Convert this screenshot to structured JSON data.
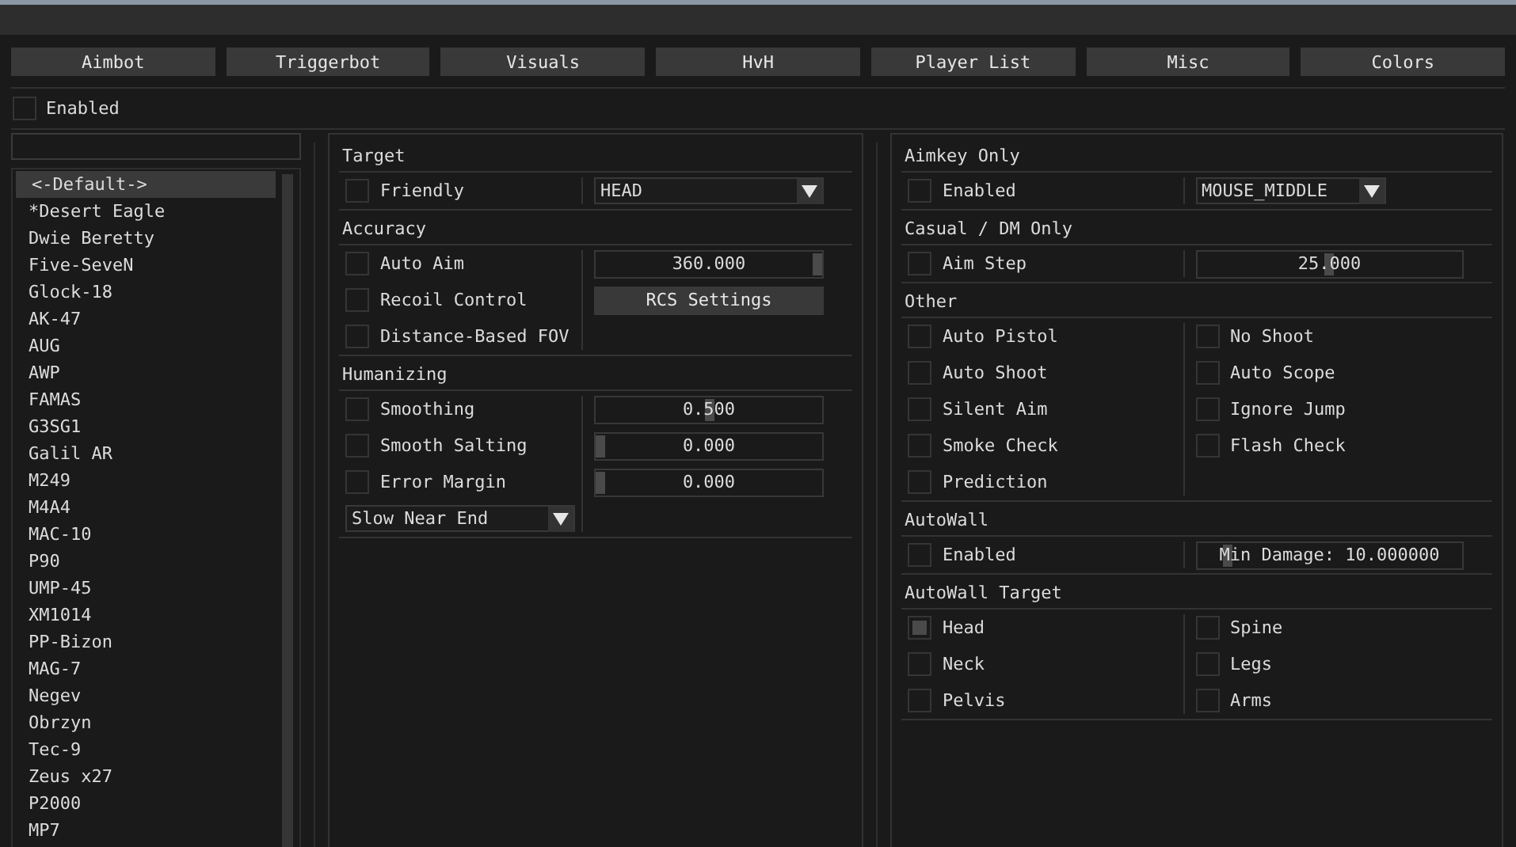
{
  "tabs": [
    {
      "label": "Aimbot"
    },
    {
      "label": "Triggerbot"
    },
    {
      "label": "Visuals"
    },
    {
      "label": "HvH"
    },
    {
      "label": "Player List"
    },
    {
      "label": "Misc"
    },
    {
      "label": "Colors"
    }
  ],
  "enabled": {
    "label": "Enabled",
    "checked": false
  },
  "weapons": [
    {
      "label": "<-Default->",
      "selected": true
    },
    {
      "label": "*Desert Eagle",
      "selected": false
    },
    {
      "label": "Dwie Beretty",
      "selected": false
    },
    {
      "label": "Five-SeveN",
      "selected": false
    },
    {
      "label": "Glock-18",
      "selected": false
    },
    {
      "label": "AK-47",
      "selected": false
    },
    {
      "label": "AUG",
      "selected": false
    },
    {
      "label": "AWP",
      "selected": false
    },
    {
      "label": "FAMAS",
      "selected": false
    },
    {
      "label": "G3SG1",
      "selected": false
    },
    {
      "label": "Galil AR",
      "selected": false
    },
    {
      "label": "M249",
      "selected": false
    },
    {
      "label": "M4A4",
      "selected": false
    },
    {
      "label": "MAC-10",
      "selected": false
    },
    {
      "label": "P90",
      "selected": false
    },
    {
      "label": "UMP-45",
      "selected": false
    },
    {
      "label": "XM1014",
      "selected": false
    },
    {
      "label": "PP-Bizon",
      "selected": false
    },
    {
      "label": "MAG-7",
      "selected": false
    },
    {
      "label": "Negev",
      "selected": false
    },
    {
      "label": "Obrzyn",
      "selected": false
    },
    {
      "label": "Tec-9",
      "selected": false
    },
    {
      "label": "Zeus x27",
      "selected": false
    },
    {
      "label": "P2000",
      "selected": false
    },
    {
      "label": "MP7",
      "selected": false
    }
  ],
  "panels": [
    {
      "sections": [
        {
          "title": "Target",
          "left": [
            {
              "kind": "checkbox",
              "label": "Friendly",
              "checked": false
            }
          ],
          "right": [
            {
              "kind": "dropdown",
              "value": "HEAD"
            }
          ]
        },
        {
          "title": "Accuracy",
          "left": [
            {
              "kind": "checkbox",
              "label": "Auto Aim",
              "checked": false
            },
            {
              "kind": "checkbox",
              "label": "Recoil Control",
              "checked": false
            },
            {
              "kind": "checkbox",
              "label": "Distance-Based FOV",
              "checked": false
            }
          ],
          "right": [
            {
              "kind": "slider",
              "value": "360.000",
              "level": 1
            },
            {
              "kind": "button",
              "label": "RCS Settings"
            }
          ]
        },
        {
          "title": "Humanizing",
          "left": [
            {
              "kind": "checkbox",
              "label": "Smoothing",
              "checked": false
            },
            {
              "kind": "checkbox",
              "label": "Smooth Salting",
              "checked": false
            },
            {
              "kind": "checkbox",
              "label": "Error Margin",
              "checked": false
            },
            {
              "kind": "dropdown",
              "value": "Slow Near End"
            }
          ],
          "right": [
            {
              "kind": "slider",
              "value": "0.500",
              "level": 0.5
            },
            {
              "kind": "slider",
              "value": "0.000",
              "level": 0
            },
            {
              "kind": "slider",
              "value": "0.000",
              "level": 0
            }
          ]
        }
      ]
    },
    {
      "sections": [
        {
          "title": "Aimkey Only",
          "left": [
            {
              "kind": "checkbox",
              "label": "Enabled",
              "checked": false
            }
          ],
          "right": [
            {
              "kind": "dropdown",
              "value": "MOUSE_MIDDLE"
            }
          ]
        },
        {
          "title": "Casual / DM Only",
          "left": [
            {
              "kind": "checkbox",
              "label": "Aim Step",
              "checked": false
            }
          ],
          "right": [
            {
              "kind": "slider",
              "value": "25.000",
              "level": 0.5
            }
          ]
        },
        {
          "title": "Other",
          "left": [
            {
              "kind": "checkbox",
              "label": "Auto Pistol",
              "checked": false
            },
            {
              "kind": "checkbox",
              "label": "Auto Shoot",
              "checked": false
            },
            {
              "kind": "checkbox",
              "label": "Silent Aim",
              "checked": false
            },
            {
              "kind": "checkbox",
              "label": "Smoke Check",
              "checked": false
            },
            {
              "kind": "checkbox",
              "label": "Prediction",
              "checked": false
            }
          ],
          "right": [
            {
              "kind": "checkbox",
              "label": "No Shoot",
              "checked": false
            },
            {
              "kind": "checkbox",
              "label": "Auto Scope",
              "checked": false
            },
            {
              "kind": "checkbox",
              "label": "Ignore Jump",
              "checked": false
            },
            {
              "kind": "checkbox",
              "label": "Flash Check",
              "checked": false
            }
          ]
        },
        {
          "title": "AutoWall",
          "left": [
            {
              "kind": "checkbox",
              "label": "Enabled",
              "checked": false
            }
          ],
          "right": [
            {
              "kind": "slider",
              "value": "Min Damage: 10.000000",
              "level": 0.1
            }
          ]
        },
        {
          "title": "AutoWall Target",
          "left": [
            {
              "kind": "checkbox",
              "label": "Head",
              "checked": true
            },
            {
              "kind": "checkbox",
              "label": "Neck",
              "checked": false
            },
            {
              "kind": "checkbox",
              "label": "Pelvis",
              "checked": false
            }
          ],
          "right": [
            {
              "kind": "checkbox",
              "label": "Spine",
              "checked": false
            },
            {
              "kind": "checkbox",
              "label": "Legs",
              "checked": false
            },
            {
              "kind": "checkbox",
              "label": "Arms",
              "checked": false
            }
          ]
        }
      ]
    }
  ]
}
